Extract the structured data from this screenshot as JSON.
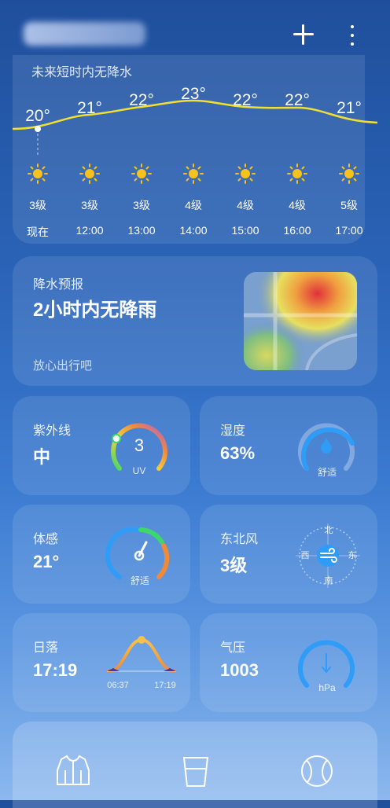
{
  "header": {
    "title_blurred": true,
    "add_icon": "plus-icon",
    "more_icon": "more-vertical-icon"
  },
  "hourly": {
    "hint": "未来短时内无降水",
    "temps": [
      "20°",
      "21°",
      "22°",
      "23°",
      "22°",
      "22°",
      "21°"
    ],
    "winds": [
      "3级",
      "3级",
      "3级",
      "4级",
      "4级",
      "4级",
      "5级"
    ],
    "times": [
      "现在",
      "12:00",
      "13:00",
      "14:00",
      "15:00",
      "16:00",
      "17:00"
    ],
    "weather_icon": "sun-icon",
    "line_color": "#f2e030"
  },
  "rain": {
    "title": "降水预报",
    "main": "2小时内无降雨",
    "sub": "放心出行吧"
  },
  "uv": {
    "title": "紫外线",
    "value": "中",
    "index": "3",
    "unit": "UV"
  },
  "humidity": {
    "title": "湿度",
    "value": "63%",
    "comfort": "舒适"
  },
  "feels": {
    "title": "体感",
    "value": "21°",
    "comfort": "舒适"
  },
  "wind": {
    "title": "东北风",
    "value": "3级",
    "north": "北",
    "south": "南",
    "east": "东",
    "west": "西"
  },
  "sunset": {
    "title": "日落",
    "value": "17:19",
    "sunrise_time": "06:37",
    "sunset_time": "17:19"
  },
  "pressure": {
    "title": "气压",
    "value": "1003",
    "unit": "hPa"
  },
  "bottom_icons": [
    "jacket-icon",
    "cup-icon",
    "ball-icon"
  ]
}
